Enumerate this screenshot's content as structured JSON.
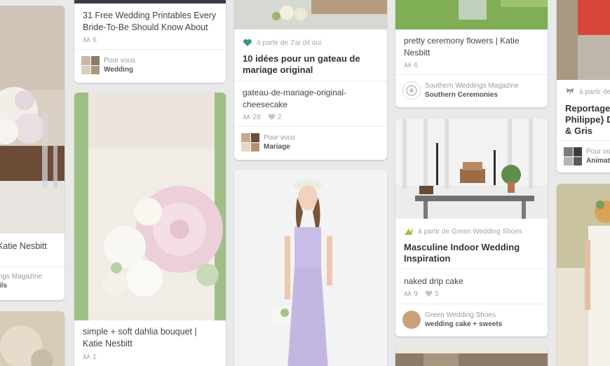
{
  "pins": {
    "col1_top": {
      "desc": "Katie Nesbitt",
      "board_line1": "dings Magazine",
      "board_line2": "tails"
    },
    "col2_top": {
      "desc": "31 Free Wedding Printables Every Bride-To-Be Should Know About",
      "repins": "6",
      "footer_line1": "Pour vous",
      "footer_line2": "Wedding"
    },
    "col2_dahlia": {
      "desc": "simple + soft dahlia bouquet | Katie Nesbitt",
      "repins": "1"
    },
    "col3_cake": {
      "via": "à partir de J'ai dit oui",
      "title": "10 idées pour un gateau de mariage original",
      "desc": "gateau-de-mariage-original-cheesecake",
      "repins": "28",
      "likes": "2",
      "footer_line1": "Pour vous",
      "footer_line2": "Mariage"
    },
    "col4_flowers": {
      "desc": "pretty ceremony flowers | Katie Nesbitt",
      "repins": "6",
      "footer_line1": "Southern Weddings Magazine",
      "footer_line2": "Southern Ceremonies"
    },
    "col4_indoor": {
      "via": "à partir de Green Wedding Shoes",
      "title": "Masculine Indoor Wedding Inspiration",
      "desc": "naked drip cake",
      "repins": "9",
      "likes": "5",
      "footer_line1": "Green Wedding Shoes",
      "footer_line2": "wedding cake + sweets"
    },
    "col5_top": {
      "via": "à partir de",
      "title": "Reportage Philippe} D & Gris",
      "footer_line1": "Pour vo",
      "footer_line2": "Animat"
    }
  },
  "colors": {
    "background": "#e9e9e9",
    "card": "#ffffff",
    "via_heart": "#3d8f8a",
    "via_green": "#9ac43c"
  },
  "icons": [
    "repin-icon",
    "heart-icon",
    "via-heart-icon",
    "via-leaf-icon",
    "via-wings-icon"
  ]
}
